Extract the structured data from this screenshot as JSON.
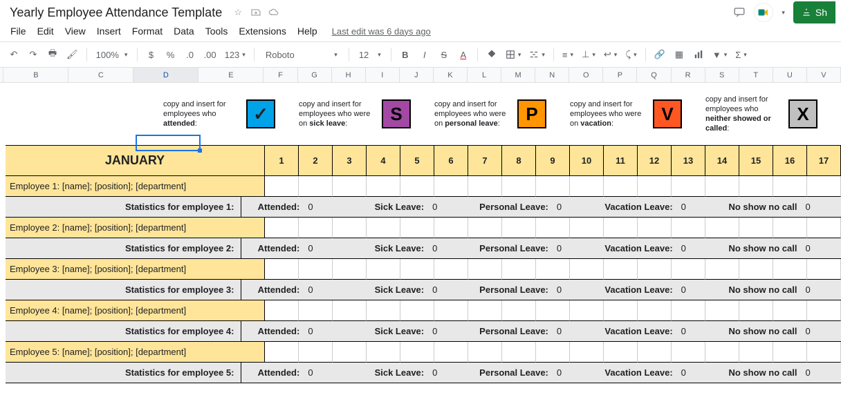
{
  "doc": {
    "title": "Yearly Employee Attendance Template",
    "last_edit": "Last edit was 6 days ago"
  },
  "menus": {
    "file": "File",
    "edit": "Edit",
    "view": "View",
    "insert": "Insert",
    "format": "Format",
    "data": "Data",
    "tools": "Tools",
    "extensions": "Extensions",
    "help": "Help"
  },
  "toolbar": {
    "zoom": "100%",
    "font": "Roboto",
    "size": "12",
    "more": "123"
  },
  "share": {
    "label": "Sh"
  },
  "columns": [
    "B",
    "C",
    "D",
    "E",
    "F",
    "G",
    "H",
    "I",
    "J",
    "K",
    "L",
    "M",
    "N",
    "O",
    "P",
    "Q",
    "R",
    "S",
    "T",
    "U",
    "V"
  ],
  "selected_col": "D",
  "legend": [
    {
      "pre": "copy and insert for employees who ",
      "bold": "attended",
      "post": ":",
      "sym": "✓",
      "cls": "c-attend"
    },
    {
      "pre": "copy and insert for employees who were on ",
      "bold": "sick leave",
      "post": ":",
      "sym": "S",
      "cls": "c-sick"
    },
    {
      "pre": "copy and insert for employees who were on ",
      "bold": "personal leave",
      "post": ":",
      "sym": "P",
      "cls": "c-pers"
    },
    {
      "pre": "copy and insert for employees who were on ",
      "bold": "vacation",
      "post": ":",
      "sym": "V",
      "cls": "c-vac"
    },
    {
      "pre": "copy and insert for employees who ",
      "bold": "neither showed or called",
      "post": ":",
      "sym": "X",
      "cls": "c-no"
    }
  ],
  "month": "JANUARY",
  "days": [
    "1",
    "2",
    "3",
    "4",
    "5",
    "6",
    "7",
    "8",
    "9",
    "10",
    "11",
    "12",
    "13",
    "14",
    "15",
    "16",
    "17"
  ],
  "stat_labels": {
    "attended": "Attended:",
    "sick": "Sick Leave:",
    "personal": "Personal Leave:",
    "vacation": "Vacation Leave:",
    "noshow": "No show no call"
  },
  "employees": [
    {
      "row": "Employee 1: [name]; [position]; [department]",
      "stat": "Statistics for employee 1:",
      "a": "0",
      "s": "0",
      "p": "0",
      "v": "0",
      "n": "0"
    },
    {
      "row": "Employee 2: [name]; [position]; [department]",
      "stat": "Statistics for employee 2:",
      "a": "0",
      "s": "0",
      "p": "0",
      "v": "0",
      "n": "0"
    },
    {
      "row": "Employee 3: [name]; [position]; [department]",
      "stat": "Statistics for employee 3:",
      "a": "0",
      "s": "0",
      "p": "0",
      "v": "0",
      "n": "0"
    },
    {
      "row": "Employee 4: [name]; [position]; [department]",
      "stat": "Statistics for employee 4:",
      "a": "0",
      "s": "0",
      "p": "0",
      "v": "0",
      "n": "0"
    },
    {
      "row": "Employee 5: [name]; [position]; [department]",
      "stat": "Statistics for employee 5:",
      "a": "0",
      "s": "0",
      "p": "0",
      "v": "0",
      "n": "0"
    }
  ]
}
